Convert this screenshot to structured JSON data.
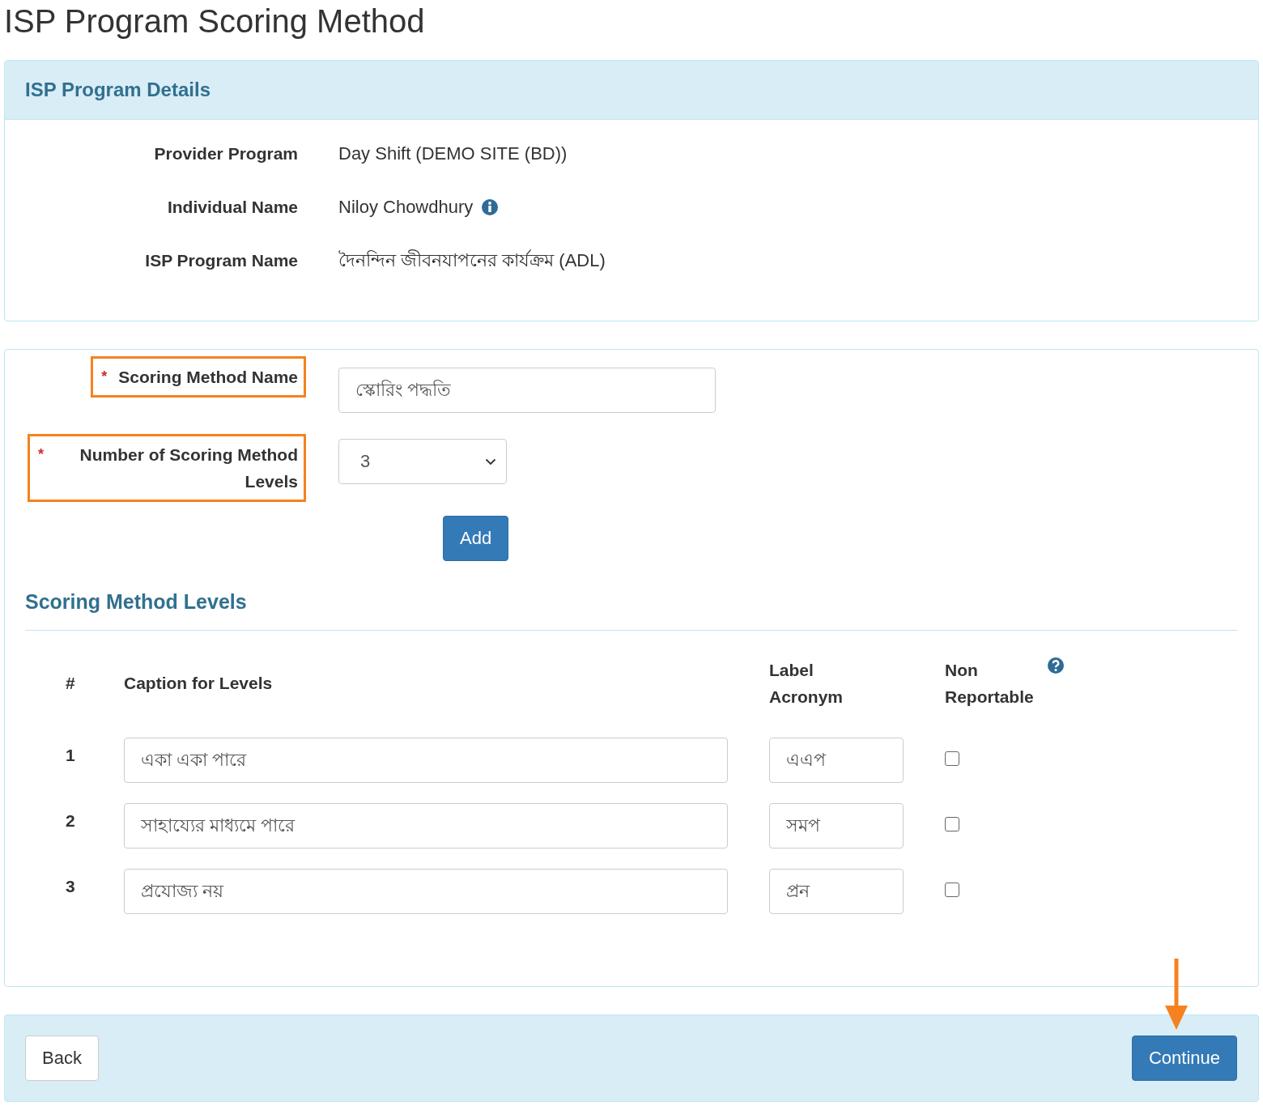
{
  "page_title": "ISP Program Scoring Method",
  "details_panel": {
    "title": "ISP Program Details",
    "rows": [
      {
        "label": "Provider Program",
        "value": "Day Shift (DEMO SITE (BD))",
        "info": false
      },
      {
        "label": "Individual Name",
        "value": "Niloy Chowdhury",
        "info": true
      },
      {
        "label": "ISP Program Name",
        "value": "দৈনন্দিন জীবনযাপনের কার্যক্রম (ADL)",
        "info": false
      }
    ]
  },
  "form": {
    "fields": [
      {
        "kind": "text",
        "label": "Scoring Method Name",
        "required_mark": "*",
        "highlighted": true,
        "value": "স্কোরিং পদ্ধতি"
      },
      {
        "kind": "select",
        "label": "Number of Scoring Method Levels",
        "required_mark": "*",
        "highlighted": true,
        "value": "3"
      }
    ],
    "add_button": "Add"
  },
  "levels": {
    "title": "Scoring Method Levels",
    "columns": [
      "#",
      "Caption for Levels",
      "Label Acronym",
      "Non Reportable"
    ],
    "rows": [
      {
        "number": "1",
        "caption": "একা একা পারে",
        "acronym": "এএপ",
        "non_reportable": false
      },
      {
        "number": "2",
        "caption": "সাহায্যের মাধ্যমে পারে",
        "acronym": "সমপ",
        "non_reportable": false
      },
      {
        "number": "3",
        "caption": "প্রযোজ্য নয়",
        "acronym": "প্রন",
        "non_reportable": false
      }
    ]
  },
  "footer": {
    "back_button": "Back",
    "continue_button": "Continue",
    "continue_highlighted": true
  }
}
